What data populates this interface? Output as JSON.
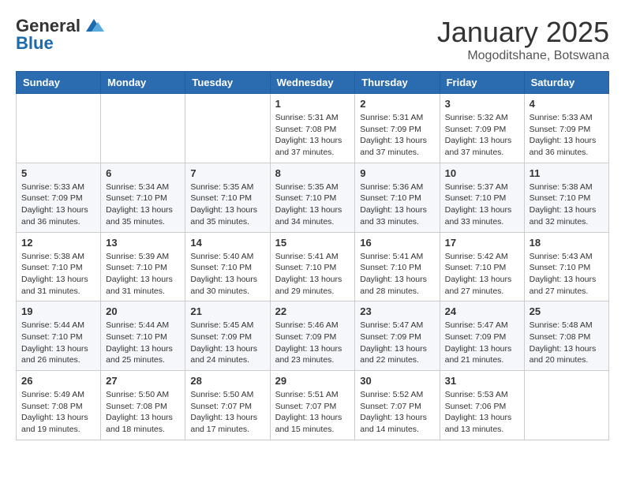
{
  "header": {
    "logo_general": "General",
    "logo_blue": "Blue",
    "month_title": "January 2025",
    "location": "Mogoditshane, Botswana"
  },
  "weekdays": [
    "Sunday",
    "Monday",
    "Tuesday",
    "Wednesday",
    "Thursday",
    "Friday",
    "Saturday"
  ],
  "weeks": [
    [
      {
        "day": "",
        "info": ""
      },
      {
        "day": "",
        "info": ""
      },
      {
        "day": "",
        "info": ""
      },
      {
        "day": "1",
        "info": "Sunrise: 5:31 AM\nSunset: 7:08 PM\nDaylight: 13 hours\nand 37 minutes."
      },
      {
        "day": "2",
        "info": "Sunrise: 5:31 AM\nSunset: 7:09 PM\nDaylight: 13 hours\nand 37 minutes."
      },
      {
        "day": "3",
        "info": "Sunrise: 5:32 AM\nSunset: 7:09 PM\nDaylight: 13 hours\nand 37 minutes."
      },
      {
        "day": "4",
        "info": "Sunrise: 5:33 AM\nSunset: 7:09 PM\nDaylight: 13 hours\nand 36 minutes."
      }
    ],
    [
      {
        "day": "5",
        "info": "Sunrise: 5:33 AM\nSunset: 7:09 PM\nDaylight: 13 hours\nand 36 minutes."
      },
      {
        "day": "6",
        "info": "Sunrise: 5:34 AM\nSunset: 7:10 PM\nDaylight: 13 hours\nand 35 minutes."
      },
      {
        "day": "7",
        "info": "Sunrise: 5:35 AM\nSunset: 7:10 PM\nDaylight: 13 hours\nand 35 minutes."
      },
      {
        "day": "8",
        "info": "Sunrise: 5:35 AM\nSunset: 7:10 PM\nDaylight: 13 hours\nand 34 minutes."
      },
      {
        "day": "9",
        "info": "Sunrise: 5:36 AM\nSunset: 7:10 PM\nDaylight: 13 hours\nand 33 minutes."
      },
      {
        "day": "10",
        "info": "Sunrise: 5:37 AM\nSunset: 7:10 PM\nDaylight: 13 hours\nand 33 minutes."
      },
      {
        "day": "11",
        "info": "Sunrise: 5:38 AM\nSunset: 7:10 PM\nDaylight: 13 hours\nand 32 minutes."
      }
    ],
    [
      {
        "day": "12",
        "info": "Sunrise: 5:38 AM\nSunset: 7:10 PM\nDaylight: 13 hours\nand 31 minutes."
      },
      {
        "day": "13",
        "info": "Sunrise: 5:39 AM\nSunset: 7:10 PM\nDaylight: 13 hours\nand 31 minutes."
      },
      {
        "day": "14",
        "info": "Sunrise: 5:40 AM\nSunset: 7:10 PM\nDaylight: 13 hours\nand 30 minutes."
      },
      {
        "day": "15",
        "info": "Sunrise: 5:41 AM\nSunset: 7:10 PM\nDaylight: 13 hours\nand 29 minutes."
      },
      {
        "day": "16",
        "info": "Sunrise: 5:41 AM\nSunset: 7:10 PM\nDaylight: 13 hours\nand 28 minutes."
      },
      {
        "day": "17",
        "info": "Sunrise: 5:42 AM\nSunset: 7:10 PM\nDaylight: 13 hours\nand 27 minutes."
      },
      {
        "day": "18",
        "info": "Sunrise: 5:43 AM\nSunset: 7:10 PM\nDaylight: 13 hours\nand 27 minutes."
      }
    ],
    [
      {
        "day": "19",
        "info": "Sunrise: 5:44 AM\nSunset: 7:10 PM\nDaylight: 13 hours\nand 26 minutes."
      },
      {
        "day": "20",
        "info": "Sunrise: 5:44 AM\nSunset: 7:10 PM\nDaylight: 13 hours\nand 25 minutes."
      },
      {
        "day": "21",
        "info": "Sunrise: 5:45 AM\nSunset: 7:09 PM\nDaylight: 13 hours\nand 24 minutes."
      },
      {
        "day": "22",
        "info": "Sunrise: 5:46 AM\nSunset: 7:09 PM\nDaylight: 13 hours\nand 23 minutes."
      },
      {
        "day": "23",
        "info": "Sunrise: 5:47 AM\nSunset: 7:09 PM\nDaylight: 13 hours\nand 22 minutes."
      },
      {
        "day": "24",
        "info": "Sunrise: 5:47 AM\nSunset: 7:09 PM\nDaylight: 13 hours\nand 21 minutes."
      },
      {
        "day": "25",
        "info": "Sunrise: 5:48 AM\nSunset: 7:08 PM\nDaylight: 13 hours\nand 20 minutes."
      }
    ],
    [
      {
        "day": "26",
        "info": "Sunrise: 5:49 AM\nSunset: 7:08 PM\nDaylight: 13 hours\nand 19 minutes."
      },
      {
        "day": "27",
        "info": "Sunrise: 5:50 AM\nSunset: 7:08 PM\nDaylight: 13 hours\nand 18 minutes."
      },
      {
        "day": "28",
        "info": "Sunrise: 5:50 AM\nSunset: 7:07 PM\nDaylight: 13 hours\nand 17 minutes."
      },
      {
        "day": "29",
        "info": "Sunrise: 5:51 AM\nSunset: 7:07 PM\nDaylight: 13 hours\nand 15 minutes."
      },
      {
        "day": "30",
        "info": "Sunrise: 5:52 AM\nSunset: 7:07 PM\nDaylight: 13 hours\nand 14 minutes."
      },
      {
        "day": "31",
        "info": "Sunrise: 5:53 AM\nSunset: 7:06 PM\nDaylight: 13 hours\nand 13 minutes."
      },
      {
        "day": "",
        "info": ""
      }
    ]
  ]
}
